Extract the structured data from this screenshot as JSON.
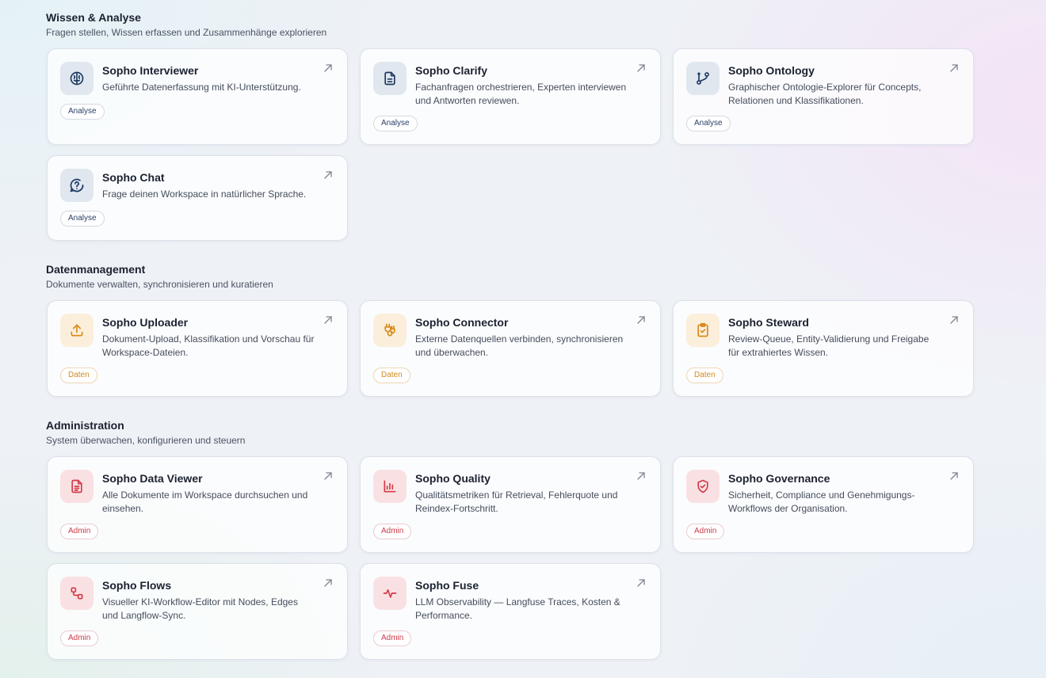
{
  "sections": [
    {
      "title": "Wissen & Analyse",
      "subtitle": "Fragen stellen, Wissen erfassen und Zusammenhänge explorieren",
      "cards": [
        {
          "title": "Sopho Interviewer",
          "description": "Geführte Datenerfassung mit KI-Unterstützung.",
          "badge": "Analyse",
          "icon": "brain-icon"
        },
        {
          "title": "Sopho Clarify",
          "description": "Fachanfragen orchestrieren, Experten interviewen und Antworten reviewen.",
          "badge": "Analyse",
          "icon": "document-icon"
        },
        {
          "title": "Sopho Ontology",
          "description": "Graphischer Ontologie-Explorer für Concepts, Relationen und Klassifikationen.",
          "badge": "Analyse",
          "icon": "git-branch-icon"
        },
        {
          "title": "Sopho Chat",
          "description": "Frage deinen Workspace in natürlicher Sprache.",
          "badge": "Analyse",
          "icon": "chat-question-icon"
        }
      ]
    },
    {
      "title": "Datenmanagement",
      "subtitle": "Dokumente verwalten, synchronisieren und kuratieren",
      "cards": [
        {
          "title": "Sopho Uploader",
          "description": "Dokument-Upload, Klassifikation und Vorschau für Workspace-Dateien.",
          "badge": "Daten",
          "icon": "upload-icon"
        },
        {
          "title": "Sopho Connector",
          "description": "Externe Datenquellen verbinden, synchronisieren und überwachen.",
          "badge": "Daten",
          "icon": "plug-icon"
        },
        {
          "title": "Sopho Steward",
          "description": "Review-Queue, Entity-Validierung und Freigabe für extrahiertes Wissen.",
          "badge": "Daten",
          "icon": "clipboard-check-icon"
        }
      ]
    },
    {
      "title": "Administration",
      "subtitle": "System überwachen, konfigurieren und steuern",
      "cards": [
        {
          "title": "Sopho Data Viewer",
          "description": "Alle Dokumente im Workspace durchsuchen und einsehen.",
          "badge": "Admin",
          "icon": "file-text-icon"
        },
        {
          "title": "Sopho Quality",
          "description": "Qualitätsmetriken für Retrieval, Fehlerquote und Reindex-Fortschritt.",
          "badge": "Admin",
          "icon": "bar-chart-icon"
        },
        {
          "title": "Sopho Governance",
          "description": "Sicherheit, Compliance und Genehmigungs-Workflows der Organisation.",
          "badge": "Admin",
          "icon": "shield-check-icon"
        },
        {
          "title": "Sopho Flows",
          "description": "Visueller KI-Workflow-Editor mit Nodes, Edges und Langflow-Sync.",
          "badge": "Admin",
          "icon": "workflow-icon"
        },
        {
          "title": "Sopho Fuse",
          "description": "LLM Observability — Langfuse Traces, Kosten & Performance.",
          "badge": "Admin",
          "icon": "activity-icon"
        }
      ]
    }
  ],
  "colors": {
    "analyse_icon": "#1d3a62",
    "daten_icon": "#d98a17",
    "admin_icon": "#d43a49"
  }
}
